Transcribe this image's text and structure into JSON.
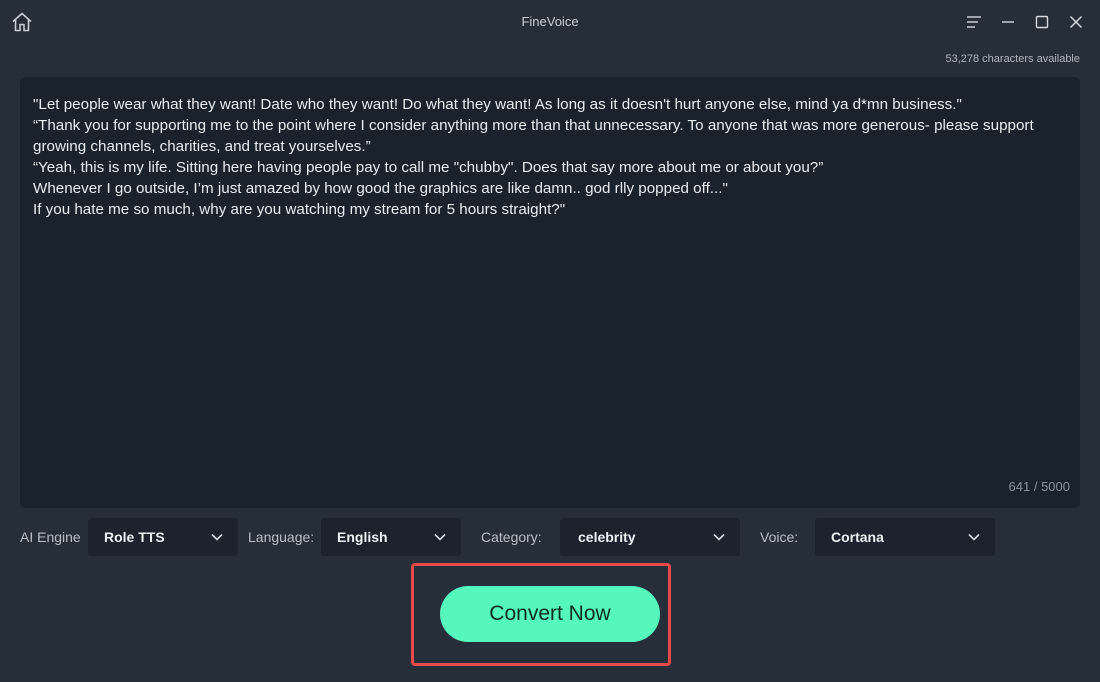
{
  "app": {
    "title": "FineVoice"
  },
  "window_controls": {
    "menu_icon": "menu-icon",
    "minimize_icon": "minimize-icon",
    "maximize_icon": "maximize-icon",
    "close_icon": "close-icon"
  },
  "header": {
    "chars_available": "53,278 characters available"
  },
  "editor": {
    "lines": [
      "\"Let people wear what they want! Date who they want! Do what they want! As long as it doesn't hurt anyone else, mind ya d*mn business.\"",
      "“Thank you for supporting me to the point where I consider anything more than that unnecessary. To anyone that was more generous- please support",
      "growing channels, charities, and treat yourselves.”",
      "“Yeah, this is my life. Sitting here having people pay to call me \"chubby\". Does that say more about me or about you?”",
      "Whenever I go outside, I’m just amazed by how good the graphics are like damn.. god rlly popped off...\"",
      "If you hate me so much, why are you watching my stream for 5 hours straight?\""
    ],
    "counter": "641 / 5000"
  },
  "controls": {
    "engine_label": "AI Engine",
    "engine_value": "Role TTS",
    "language_label": "Language:",
    "language_value": "English",
    "category_label": "Category:",
    "category_value": "celebrity",
    "voice_label": "Voice:",
    "voice_value": "Cortana"
  },
  "convert": {
    "label": "Convert Now"
  },
  "colors": {
    "accent": "#56f6bf",
    "highlight": "#e84a4a",
    "background": "#262e39",
    "editor": "#1a222d"
  }
}
